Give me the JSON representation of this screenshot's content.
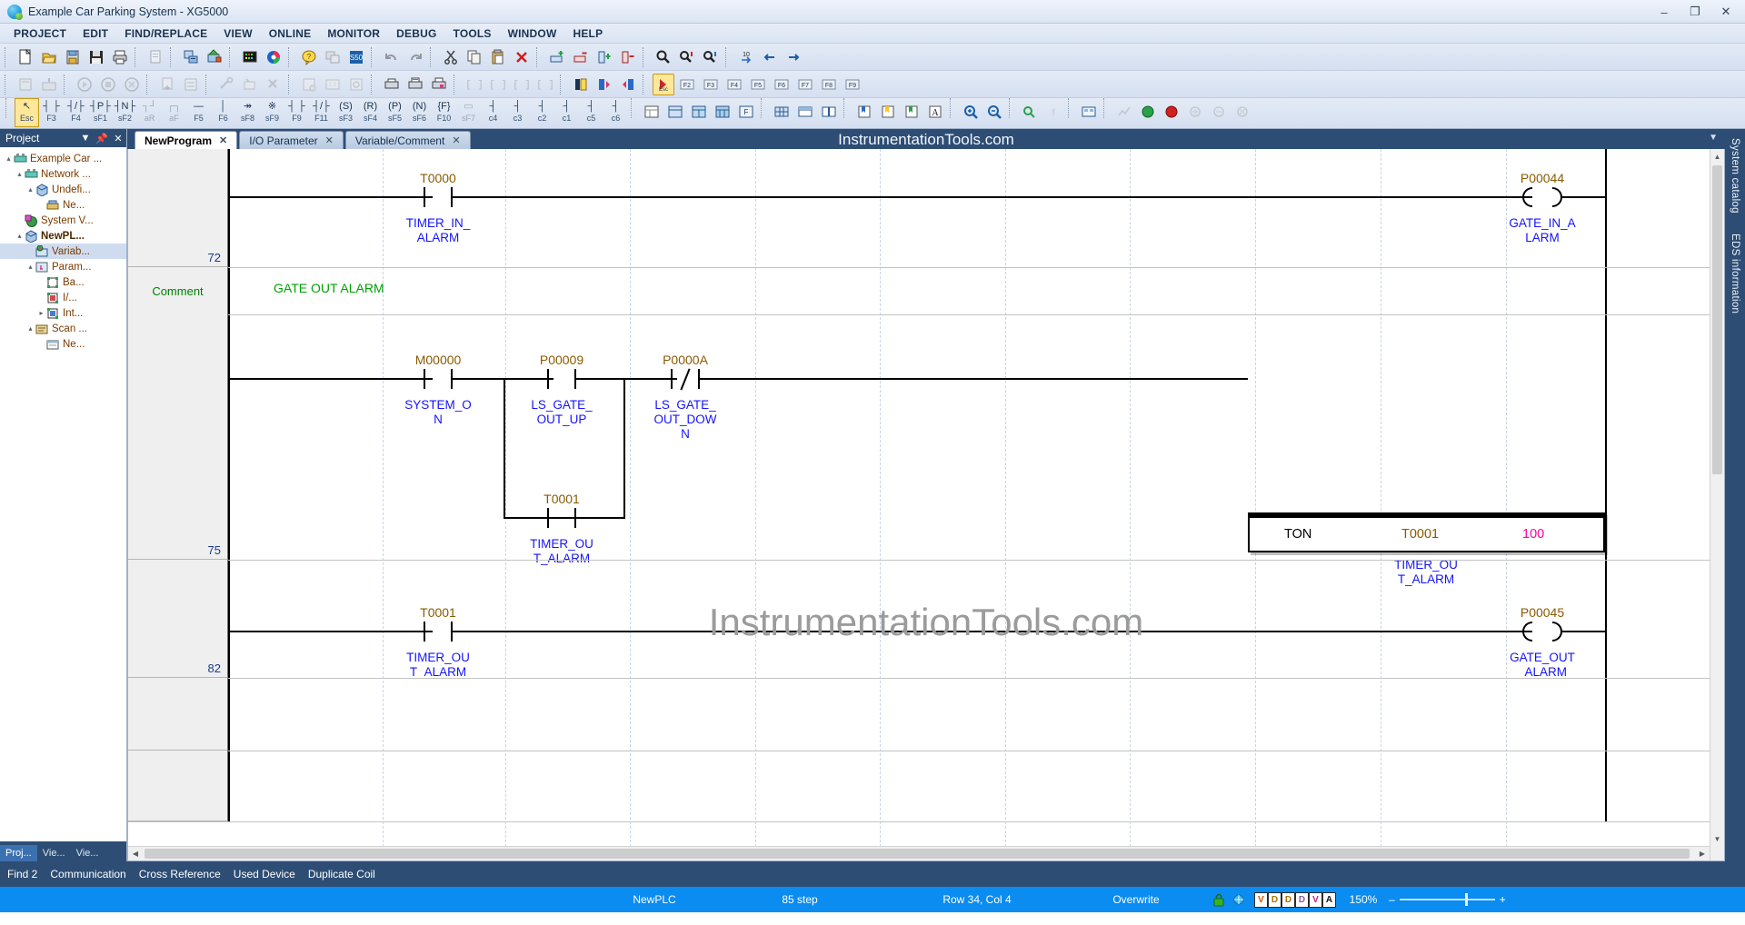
{
  "window": {
    "title": "Example Car Parking System - XG5000",
    "app_icon": "xg5000-icon",
    "minimize": "–",
    "maximize": "❐",
    "close": "✕"
  },
  "menubar": {
    "items": [
      "PROJECT",
      "EDIT",
      "FIND/REPLACE",
      "VIEW",
      "ONLINE",
      "MONITOR",
      "DEBUG",
      "TOOLS",
      "WINDOW",
      "HELP"
    ]
  },
  "ladder_toolbar": {
    "items": [
      {
        "glyph": "↖",
        "key": "Esc",
        "selected": true,
        "name": "select-tool"
      },
      {
        "glyph": "┤ ├",
        "key": "F3",
        "name": "normally-open-contact-tool"
      },
      {
        "glyph": "┤/├",
        "key": "F4",
        "name": "normally-closed-contact-tool"
      },
      {
        "glyph": "┤P├",
        "key": "sF1",
        "name": "positive-transition-contact-tool"
      },
      {
        "glyph": "┤N├",
        "key": "sF2",
        "name": "negative-transition-contact-tool"
      },
      {
        "glyph": "┐┘",
        "key": "aR",
        "name": "rising-pulse-tool"
      },
      {
        "glyph": "┌┐",
        "key": "aF",
        "name": "falling-pulse-tool"
      },
      {
        "glyph": "—",
        "key": "F5",
        "name": "horizontal-line-tool"
      },
      {
        "glyph": "│",
        "key": "F6",
        "name": "vertical-line-tool"
      },
      {
        "glyph": "↠",
        "key": "sF8",
        "name": "line-delete-tool"
      },
      {
        "glyph": "※",
        "key": "sF9",
        "name": "line-insert-tool"
      },
      {
        "glyph": "┤ ├",
        "key": "F9",
        "name": "coil-tool"
      },
      {
        "glyph": "┤/├",
        "key": "F11",
        "name": "negated-coil-tool"
      },
      {
        "glyph": "(S)",
        "key": "sF3",
        "name": "set-coil-tool"
      },
      {
        "glyph": "(R)",
        "key": "sF4",
        "name": "reset-coil-tool"
      },
      {
        "glyph": "(P)",
        "key": "sF5",
        "name": "positive-coil-tool"
      },
      {
        "glyph": "(N)",
        "key": "sF6",
        "name": "negative-coil-tool"
      },
      {
        "glyph": "{F}",
        "key": "F10",
        "name": "function-block-tool"
      },
      {
        "glyph": "▭",
        "key": "sF7",
        "dim": true,
        "name": "instruction-box-tool"
      },
      {
        "glyph": "┤",
        "key": "c4",
        "name": "call-tool"
      },
      {
        "glyph": "┤",
        "key": "c3",
        "name": "jump-tool"
      },
      {
        "glyph": "┤",
        "key": "c2",
        "name": "label-tool"
      },
      {
        "glyph": "┤",
        "key": "c1",
        "name": "end-tool"
      },
      {
        "glyph": "┤",
        "key": "c5",
        "name": "subroutine-tool"
      },
      {
        "glyph": "┤",
        "key": "c6",
        "name": "return-tool"
      }
    ]
  },
  "project_panel": {
    "title": "Project",
    "dropdown_icon": "chevron-down-icon",
    "pin_icon": "pin-icon",
    "close_icon": "close-icon",
    "tree": [
      {
        "label": "Example Car ...",
        "depth": 0,
        "expander": "▴",
        "icon": "project-icon",
        "bold": false
      },
      {
        "label": "Network ...",
        "depth": 1,
        "expander": "▴",
        "icon": "network-icon",
        "bold": false
      },
      {
        "label": "Undefi...",
        "depth": 2,
        "expander": "▴",
        "icon": "plc-cube-icon",
        "bold": false
      },
      {
        "label": "Ne...",
        "depth": 3,
        "expander": "",
        "icon": "device-icon",
        "bold": false
      },
      {
        "label": "System V...",
        "depth": 1,
        "expander": "",
        "icon": "system-variable-icon",
        "bold": false
      },
      {
        "label": "NewPL...",
        "depth": 1,
        "expander": "▴",
        "icon": "plc-cube-icon",
        "bold": true
      },
      {
        "label": "Variab...",
        "depth": 2,
        "expander": "",
        "icon": "variable-icon",
        "bold": false,
        "selected": true
      },
      {
        "label": "Param...",
        "depth": 2,
        "expander": "▴",
        "icon": "parameter-icon",
        "bold": false
      },
      {
        "label": "Ba...",
        "depth": 3,
        "expander": "",
        "icon": "basic-param-icon",
        "bold": false
      },
      {
        "label": "I/...",
        "depth": 3,
        "expander": "",
        "icon": "io-param-icon",
        "bold": false
      },
      {
        "label": "Int...",
        "depth": 3,
        "expander": "▸",
        "icon": "internal-param-icon",
        "bold": false
      },
      {
        "label": "Scan ...",
        "depth": 2,
        "expander": "▴",
        "icon": "scan-program-icon",
        "bold": false
      },
      {
        "label": "Ne...",
        "depth": 3,
        "expander": "",
        "icon": "program-icon",
        "bold": false
      }
    ],
    "bottom_tabs": [
      {
        "label": "Proj...",
        "active": true
      },
      {
        "label": "Vie...",
        "active": false
      },
      {
        "label": "Vie...",
        "active": false
      }
    ]
  },
  "editor": {
    "watermark_top": "InstrumentationTools.com",
    "watermark_center": "InstrumentationTools.com",
    "tabs": [
      {
        "label": "NewProgram",
        "close": "✕",
        "active": true
      },
      {
        "label": "I/O Parameter",
        "close": "✕",
        "active": false
      },
      {
        "label": "Variable/Comment",
        "close": "✕",
        "active": false
      }
    ],
    "strip_caret": "▼"
  },
  "ladder": {
    "comment_label": "Comment",
    "comment_text": "GATE OUT ALARM",
    "rungs": [
      {
        "number": "72",
        "contacts": [
          {
            "address": "T0000",
            "symbol": "TIMER_IN_\nALARM",
            "type": "no"
          }
        ],
        "coil": {
          "address": "P00044",
          "symbol": "GATE_IN_A\nLARM"
        }
      },
      {
        "number": "75",
        "contacts": [
          {
            "address": "M00000",
            "symbol": "SYSTEM_O\nN",
            "type": "no"
          },
          {
            "address": "P00009",
            "symbol": "LS_GATE_\nOUT_UP",
            "type": "no"
          },
          {
            "address": "P0000A",
            "symbol": "LS_GATE_\nOUT_DOW\nN",
            "type": "nc"
          }
        ],
        "branch": {
          "address": "T0001",
          "symbol": "TIMER_OU\nT_ALARM",
          "type": "no"
        },
        "function_block": {
          "name": "TON",
          "device": "T0001",
          "value": "100",
          "symbol": "TIMER_OU\nT_ALARM"
        }
      },
      {
        "number": "82",
        "contacts": [
          {
            "address": "T0001",
            "symbol": "TIMER_OU\nT_ALARM",
            "type": "no"
          }
        ],
        "coil": {
          "address": "P00045",
          "symbol": "GATE_OUT\n_ALARM"
        }
      }
    ]
  },
  "right_dock": {
    "tabs": [
      "System catalog",
      "EDS information"
    ]
  },
  "output_bar": {
    "tabs": [
      "Find 2",
      "Communication",
      "Cross Reference",
      "Used Device",
      "Duplicate Coil"
    ]
  },
  "statusbar": {
    "plc": "NewPLC",
    "step": "85 step",
    "position": "Row 34, Col 4",
    "mode": "Overwrite",
    "lock_icon": "lock-icon",
    "connect_icon": "connection-icon",
    "doc_icons": [
      "V",
      "D",
      "DV",
      "Dc",
      "Vc",
      "A"
    ],
    "zoom": "150%",
    "zoom_out": "–",
    "zoom_in": "+"
  },
  "colors": {
    "accent": "#0a8cf0",
    "dock": "#2d4d74",
    "address": "#8a5a00",
    "symbol": "#1414ff",
    "comment": "#00a000",
    "value": "#ff00a0",
    "rownum": "#1a3c8c"
  }
}
